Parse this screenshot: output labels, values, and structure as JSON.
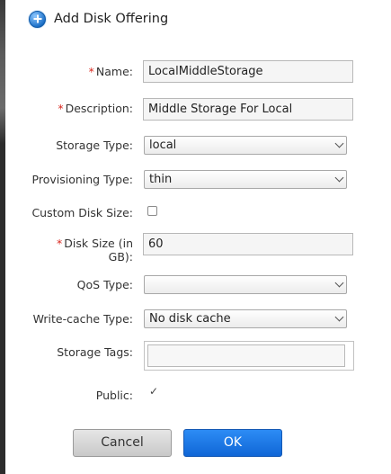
{
  "dialog": {
    "title": "Add Disk Offering",
    "icon": "add-circle-icon"
  },
  "form": {
    "name_label": "Name:",
    "name_value": "LocalMiddleStorage",
    "description_label": "Description:",
    "description_value": "Middle Storage For Local",
    "storage_type_label": "Storage Type:",
    "storage_type_value": "local",
    "provisioning_type_label": "Provisioning Type:",
    "provisioning_type_value": "thin",
    "custom_disk_size_label": "Custom Disk Size:",
    "custom_disk_size_checked": false,
    "disk_size_label_line1": "Disk Size (in",
    "disk_size_label_line2": "GB):",
    "disk_size_value": "60",
    "qos_type_label": "QoS Type:",
    "qos_type_value": "",
    "write_cache_label": "Write-cache Type:",
    "write_cache_value": "No disk cache",
    "storage_tags_label": "Storage Tags:",
    "storage_tags_value": "",
    "public_label": "Public:",
    "public_checked": true,
    "required_marker": "*"
  },
  "buttons": {
    "cancel": "Cancel",
    "ok": "OK"
  },
  "colors": {
    "required": "#d9281f",
    "ok_button": "#1a73e0"
  }
}
